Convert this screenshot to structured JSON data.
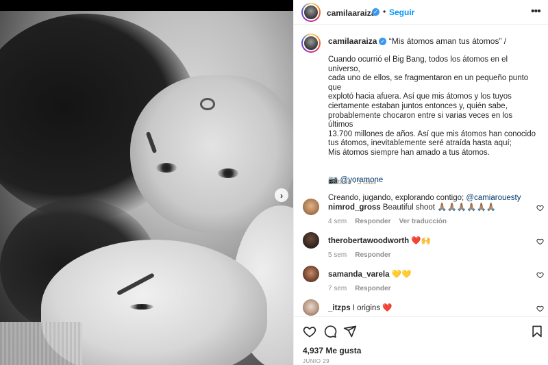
{
  "post": {
    "username": "camilaaraiza",
    "follow_label": "Seguir",
    "dot": "•",
    "more": "•••"
  },
  "caption": {
    "username": "camilaaraiza",
    "title": "“Mis átomos aman tus átomos” /",
    "paragraph_lines": [
      "Cuando ocurrió el Big Bang, todos los átomos en el universo,",
      "cada uno de ellos, se fragmentaron en un pequeño punto que",
      "explotó hacia afuera. Así que mis átomos y los tuyos",
      "ciertamente estaban juntos entonces y, quién sabe,",
      "probablemente chocaron entre si varias veces en los últimos",
      "13.700 millones de años. Así que mis átomos han conocido",
      "tus átomos, inevitablemente seré atraída hasta aquí;",
      "Mis átomos siempre han amado a tus átomos."
    ],
    "credit_prefix": "📷 ",
    "credit_mention": "@yoramone",
    "closing_prefix": "Creando, jugando, explorando contigo; ",
    "closing_mention": "@camiarouesty",
    "edited": "Editado · 3 días"
  },
  "comments": [
    {
      "user": "nimrod_gross",
      "text": "Beautiful shoot 🙏🏽🙏🏽🙏🏽🙏🏽🙏🏽🙏🏽",
      "time": "4 sem",
      "reply": "Responder",
      "extra": "Ver traducción"
    },
    {
      "user": "therobertawoodworth",
      "text": "❤️🙌",
      "time": "5 sem",
      "reply": "Responder",
      "extra": ""
    },
    {
      "user": "samanda_varela",
      "text": "💛💛",
      "time": "7 sem",
      "reply": "Responder",
      "extra": ""
    },
    {
      "user": "_itzps",
      "text": "I origins ❤️",
      "time": "",
      "reply": "",
      "extra": ""
    }
  ],
  "footer": {
    "likes": "4,937 Me gusta",
    "date": "JUNIO 29"
  },
  "icons": {
    "next": "›",
    "verified": "✓"
  },
  "colors": {
    "follow_blue": "#0095f6",
    "verified_blue": "#3897f0",
    "mention_blue": "#00376b",
    "meta_gray": "#8e8e8e"
  }
}
